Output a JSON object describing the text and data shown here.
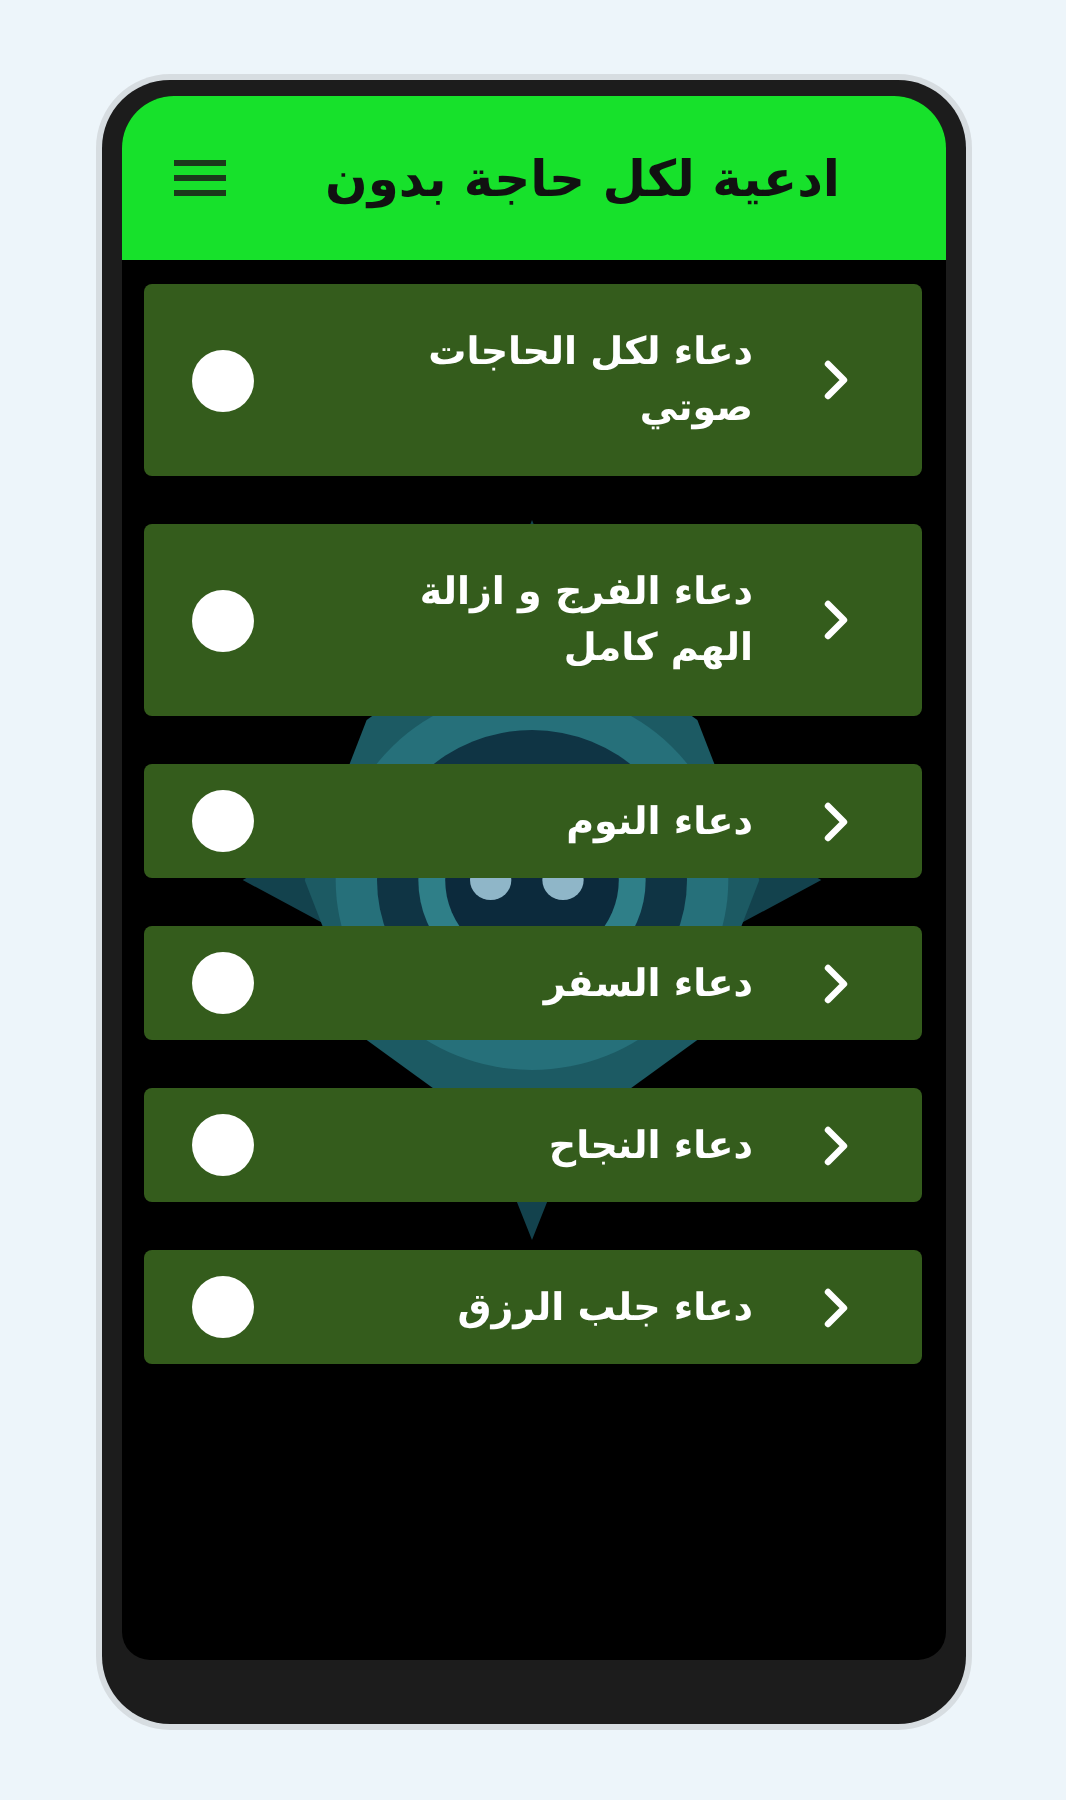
{
  "app_bar": {
    "title": "ادعية لكل حاجة بدون"
  },
  "items": [
    {
      "lines": [
        "دعاء لكل الحاجات",
        "صوتي"
      ]
    },
    {
      "lines": [
        "دعاء الفرج و ازالة",
        "الهم كامل"
      ]
    },
    {
      "lines": [
        "دعاء النوم"
      ]
    },
    {
      "lines": [
        "دعاء السفر"
      ]
    },
    {
      "lines": [
        "دعاء النجاح"
      ]
    },
    {
      "lines": [
        "دعاء جلب الرزق"
      ]
    }
  ]
}
